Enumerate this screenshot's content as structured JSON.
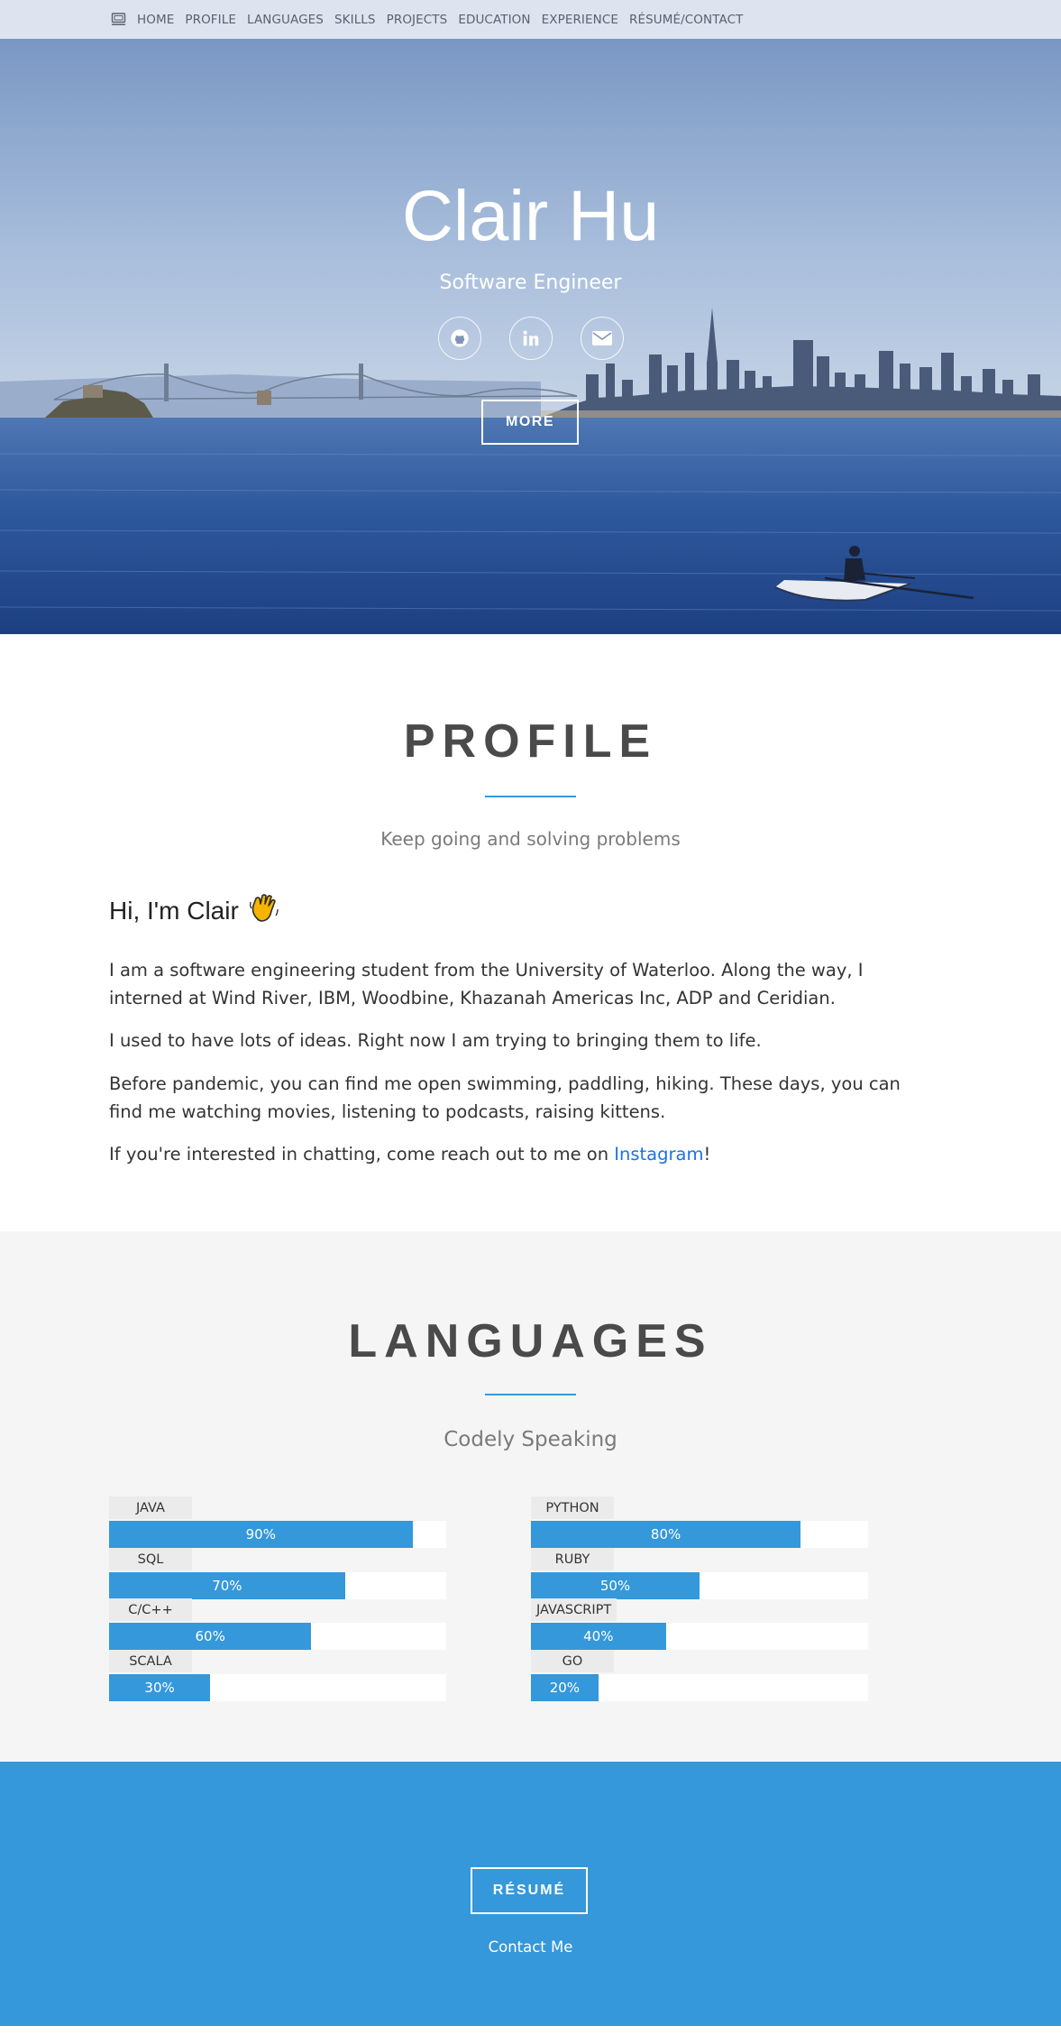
{
  "nav": {
    "brand_icon": "laptop-icon",
    "items": [
      "HOME",
      "PROFILE",
      "LANGUAGES",
      "SKILLS",
      "PROJECTS",
      "EDUCATION",
      "EXPERIENCE",
      "RÉSUMÉ/CONTACT"
    ]
  },
  "hero": {
    "name": "Clair Hu",
    "role": "Software Engineer",
    "socials": [
      {
        "icon": "github-icon"
      },
      {
        "icon": "linkedin-icon"
      },
      {
        "icon": "envelope-icon"
      }
    ],
    "more_label": "MORE"
  },
  "profile": {
    "title": "PROFILE",
    "subtitle": "Keep going and solving problems",
    "greeting": "Hi, I'm Clair",
    "greeting_emoji": "👋",
    "paragraph_1": "I am a software engineering student from the University of Waterloo. Along the way, I interned at Wind River, IBM, Woodbine, Khazanah Americas Inc, ADP and Ceridian.",
    "paragraph_2": "I used to have lots of ideas. Right now I am trying to bringing them to life.",
    "paragraph_3": "Before pandemic, you can find me open swimming, paddling, hiking. These days, you can find me watching movies, listening to podcasts, raising kittens.",
    "paragraph_4_prefix": "If you're interested in chatting, come reach out to me on ",
    "paragraph_4_link": "Instagram",
    "paragraph_4_suffix": "!"
  },
  "languages": {
    "title": "LANGUAGES",
    "subtitle": "Codely Speaking",
    "left": [
      {
        "name": "JAVA",
        "percent": 90,
        "label": "90%"
      },
      {
        "name": "SQL",
        "percent": 70,
        "label": "70%"
      },
      {
        "name": "C/C++",
        "percent": 60,
        "label": "60%"
      },
      {
        "name": "SCALA",
        "percent": 30,
        "label": "30%"
      }
    ],
    "right": [
      {
        "name": "PYTHON",
        "percent": 80,
        "label": "80%"
      },
      {
        "name": "RUBY",
        "percent": 50,
        "label": "50%"
      },
      {
        "name": "JAVASCRIPT",
        "percent": 40,
        "label": "40%"
      },
      {
        "name": "GO",
        "percent": 20,
        "label": "20%"
      }
    ]
  },
  "footer": {
    "resume_label": "RÉSUMÉ",
    "contact_label": "Contact Me"
  },
  "colors": {
    "accent": "#3498db",
    "nav_bg": "#dde4ef",
    "heading": "#4a4a4a"
  }
}
